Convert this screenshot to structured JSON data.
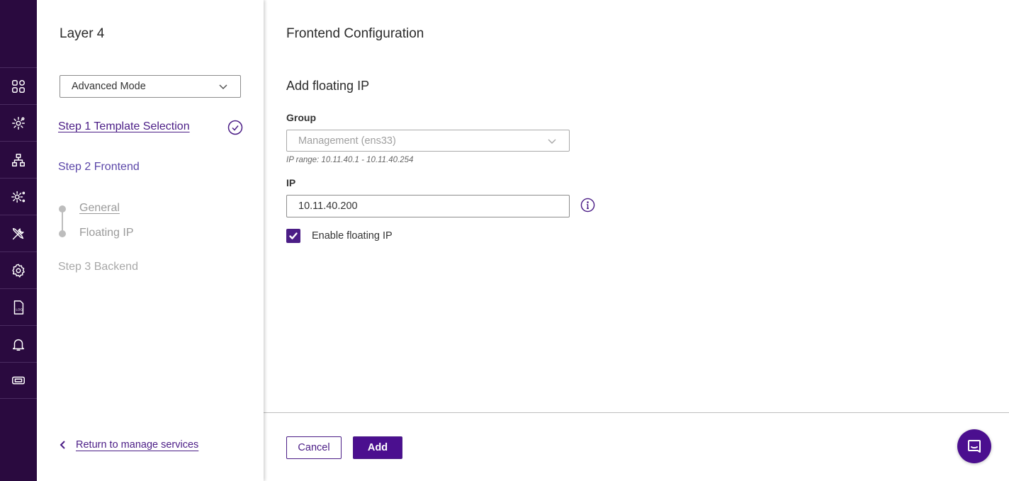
{
  "rail": {
    "items": [
      {
        "icon": "dashboard-grid-icon"
      },
      {
        "icon": "gear-network-icon"
      },
      {
        "icon": "network-topology-icon"
      },
      {
        "icon": "services-gear-icon"
      },
      {
        "icon": "tools-icon"
      },
      {
        "icon": "settings-gear-icon"
      },
      {
        "icon": "log-file-icon",
        "text": "LOG"
      },
      {
        "icon": "bell-icon"
      },
      {
        "icon": "ticket-icon"
      }
    ]
  },
  "sidebar": {
    "title": "Layer 4",
    "mode_select": {
      "value": "Advanced Mode"
    },
    "steps": {
      "step1": "Step 1 Template Selection",
      "step2": "Step 2 Frontend",
      "sub_general": "General",
      "sub_floating_ip": "Floating IP",
      "step3": "Step 3 Backend"
    },
    "return_link": "Return to manage services"
  },
  "main": {
    "title": "Frontend Configuration",
    "section_title": "Add floating IP",
    "group": {
      "label": "Group",
      "value": "Management (ens33)",
      "hint": "IP range: 10.11.40.1 - 10.11.40.254"
    },
    "ip": {
      "label": "IP",
      "value": "10.11.40.200"
    },
    "enable_checkbox": {
      "label": "Enable floating IP",
      "checked": true
    },
    "buttons": {
      "cancel": "Cancel",
      "add": "Add"
    }
  },
  "colors": {
    "accent": "#4b1d86",
    "rail_bg": "#2a0a3f",
    "button_primary": "#4b0f8f"
  }
}
